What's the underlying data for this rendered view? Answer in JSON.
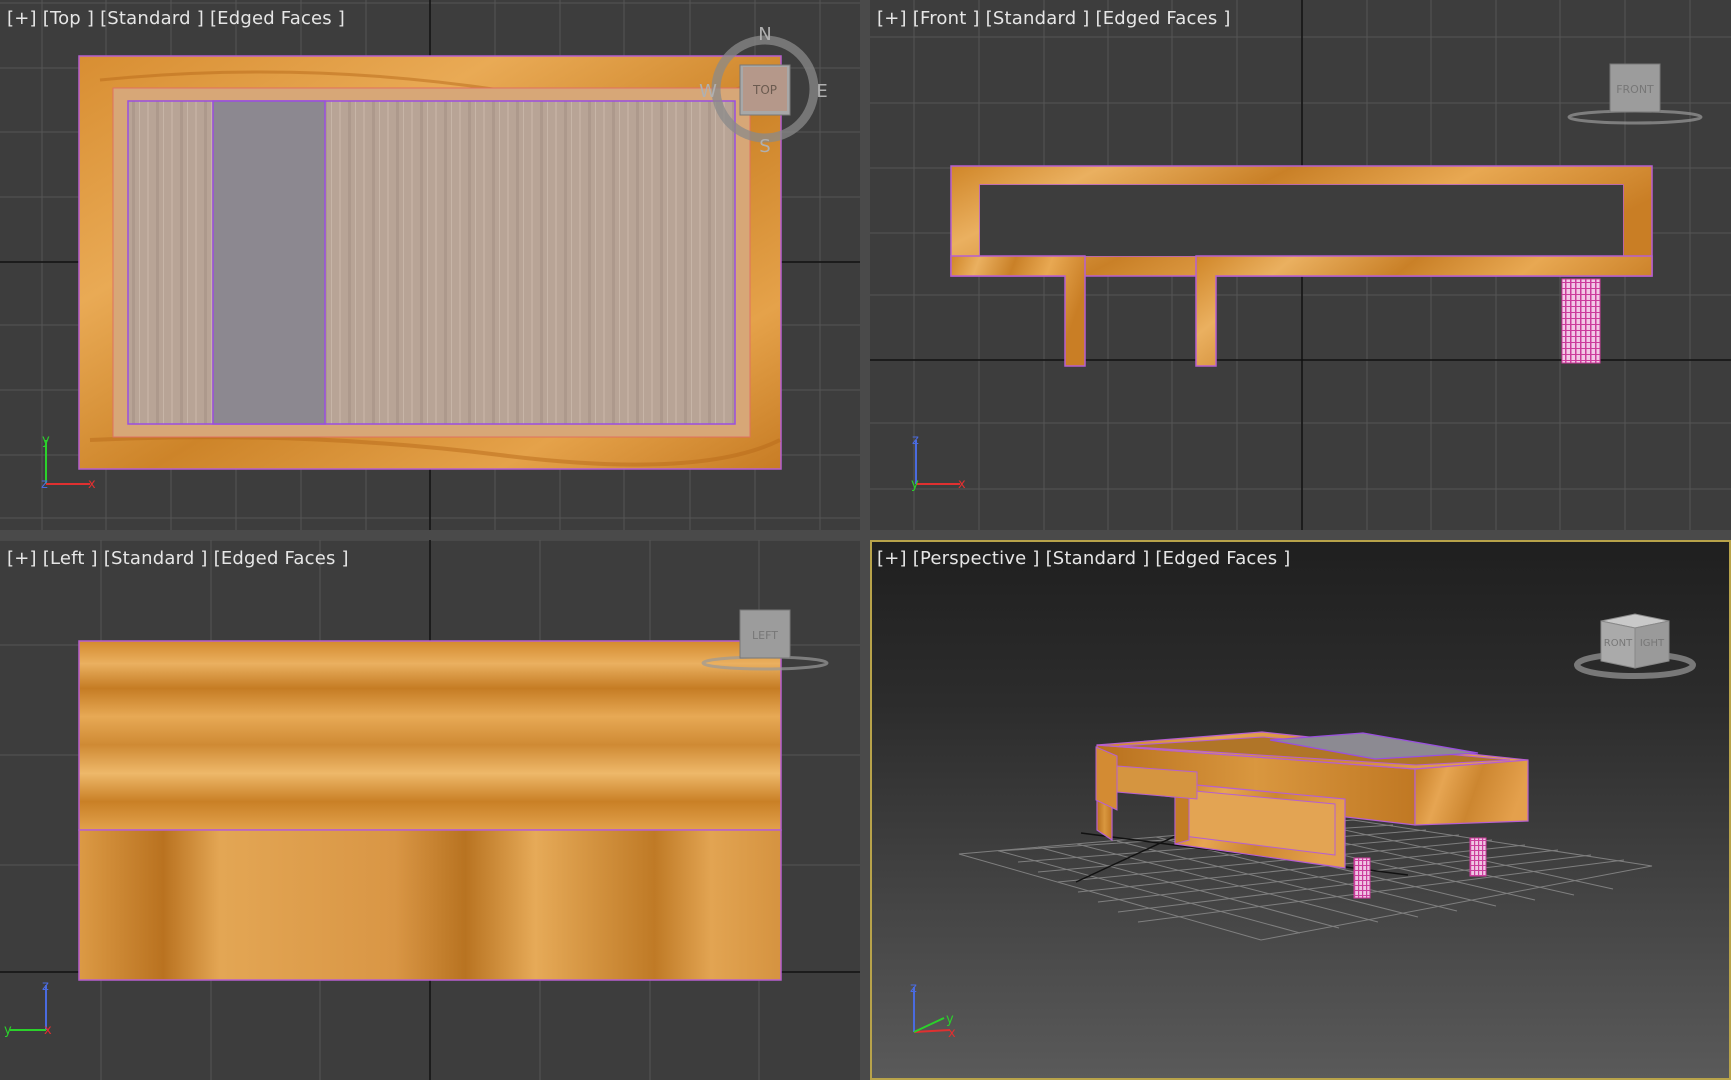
{
  "viewports": {
    "top": {
      "plus": "[+]",
      "view": "[Top ]",
      "shading": "[Standard ]",
      "faces": "[Edged Faces ]",
      "cube_label": "TOP",
      "compass": {
        "n": "N",
        "s": "S",
        "e": "E",
        "w": "W"
      },
      "axes": {
        "x": "x",
        "y": "y",
        "z": "z"
      }
    },
    "front": {
      "plus": "[+]",
      "view": "[Front ]",
      "shading": "[Standard ]",
      "faces": "[Edged Faces ]",
      "cube_label": "FRONT",
      "axes": {
        "x": "x",
        "y": "y",
        "z": "z"
      }
    },
    "left": {
      "plus": "[+]",
      "view": "[Left ]",
      "shading": "[Standard ]",
      "faces": "[Edged Faces ]",
      "cube_label": "LEFT",
      "axes": {
        "x": "x",
        "y": "y",
        "z": "z"
      }
    },
    "perspective": {
      "plus": "[+]",
      "view": "[Perspective ]",
      "shading": "[Standard ]",
      "faces": "[Edged Faces ]",
      "cube_label_front": "RONT",
      "cube_label_right": "IGHT",
      "axes": {
        "x": "x",
        "y": "y",
        "z": "z"
      }
    }
  },
  "active_viewport": "perspective",
  "colors": {
    "viewport_bg": "#3d3d3d",
    "grid": "#555555",
    "grid_axis": "#111111",
    "wood_light": "#e3a24a",
    "wood_dark": "#c47a22",
    "glass": "#b3a297",
    "selection": "#a34fd8",
    "leg": "#cc3d9c",
    "active_border": "#b8a34a"
  }
}
